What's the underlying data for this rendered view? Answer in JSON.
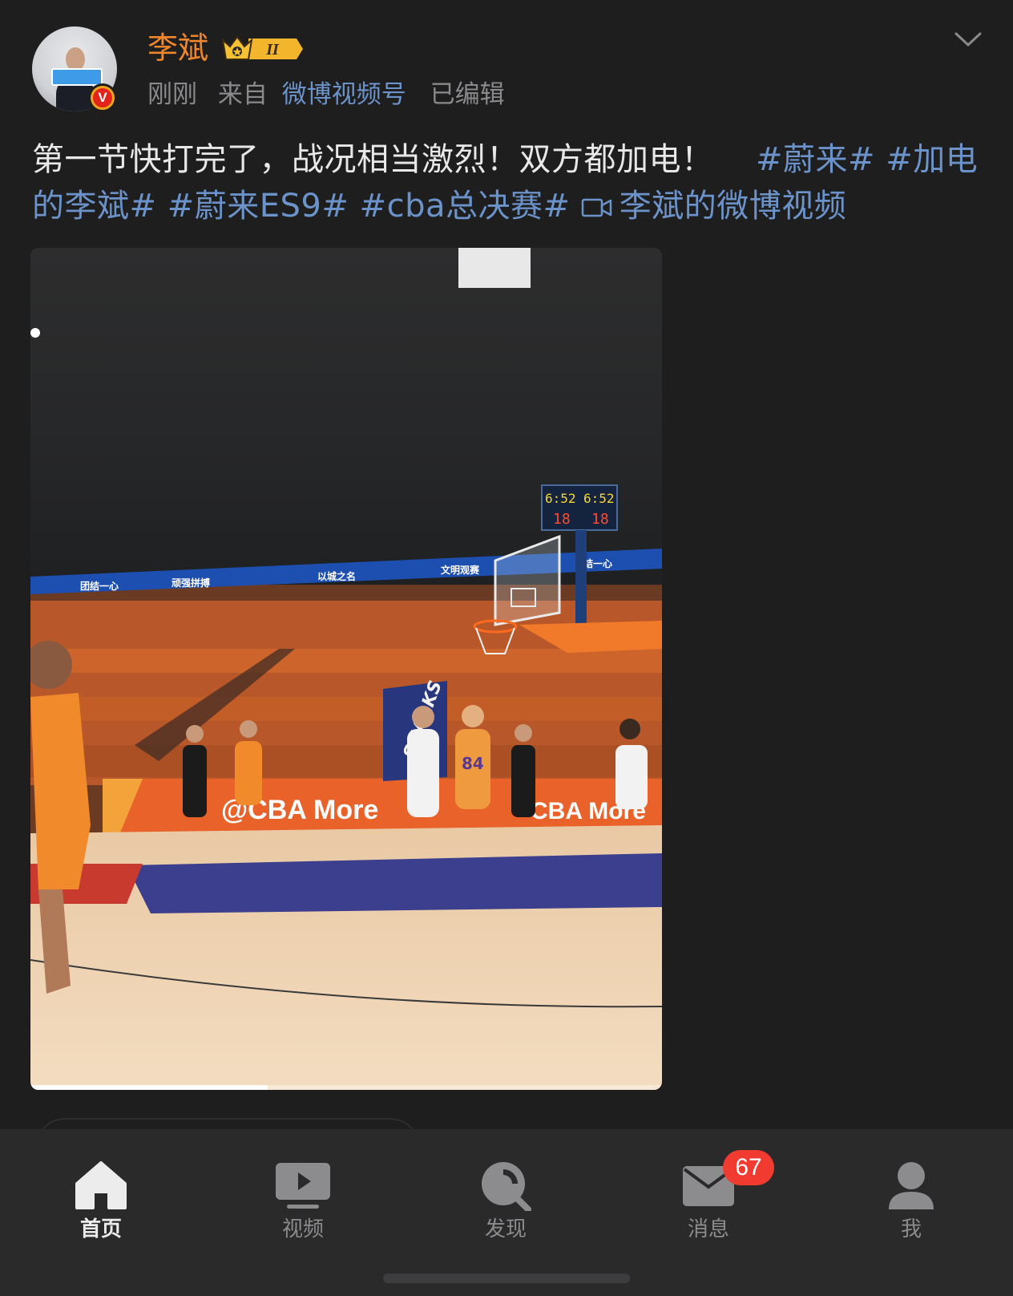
{
  "post": {
    "author": {
      "name": "李斌",
      "level_badge": "II"
    },
    "meta": {
      "time": "刚刚",
      "from_prefix": "来自",
      "source": "微博视频号",
      "edited": "已编辑"
    },
    "content": {
      "text": "第一节快打完了，战况相当激烈！双方都加电！",
      "tags": [
        "#蔚来#",
        "#加电的李斌#",
        "#蔚来ES9#",
        "#cba总决赛#"
      ],
      "video_link": "李斌的微博视频"
    },
    "video": {
      "progress": 0.375,
      "scene_text": {
        "banner_1": "团结一心",
        "banner_2": "顽强拼搏",
        "banner_3": "以城之名",
        "banner_4": "文明观赛",
        "banner_5": "结一心",
        "scoreboard_1": "6:52",
        "scoreboard_2": "18",
        "courtside": "@CBA More",
        "courtside_2": "CBA More",
        "jersey": "84",
        "team": "SHARKS"
      }
    }
  },
  "tabbar": {
    "items": [
      {
        "label": "首页",
        "icon": "home-icon",
        "active": true
      },
      {
        "label": "视频",
        "icon": "video-play-icon"
      },
      {
        "label": "发现",
        "icon": "discover-icon"
      },
      {
        "label": "消息",
        "icon": "message-icon",
        "badge": "67"
      },
      {
        "label": "我",
        "icon": "profile-icon"
      }
    ]
  },
  "colors": {
    "background": "#1e1e1f",
    "username": "#f0862b",
    "link": "#6b93c9",
    "badge": "#f23b30",
    "tabbar": "#2a2a2b"
  }
}
